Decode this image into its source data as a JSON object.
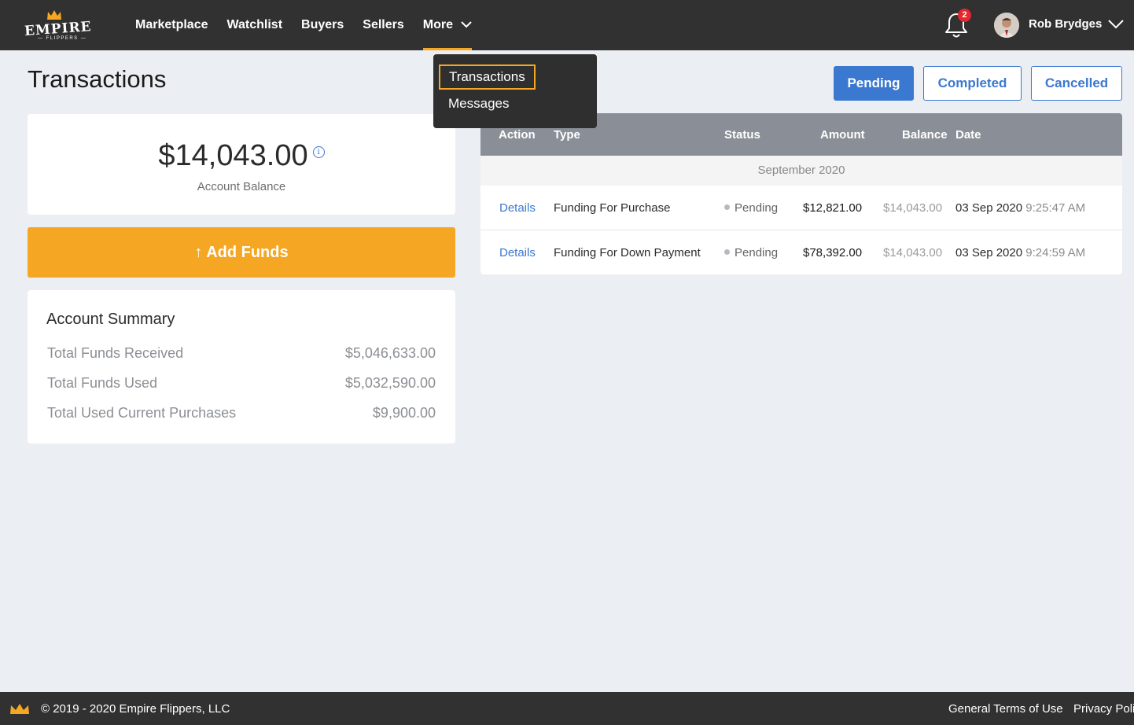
{
  "brand": {
    "name": "EMPIRE",
    "sub": "— FLIPPERS —",
    "accent": "#f5a623",
    "link_color": "#3b78d0"
  },
  "nav": {
    "items": [
      "Marketplace",
      "Watchlist",
      "Buyers",
      "Sellers"
    ],
    "more_label": "More"
  },
  "notifications": {
    "count": "2"
  },
  "user": {
    "name": "Rob Brydges"
  },
  "dropdown": {
    "items": [
      "Transactions",
      "Messages"
    ]
  },
  "page": {
    "title": "Transactions"
  },
  "balance": {
    "amount": "$14,043.00",
    "label": "Account Balance",
    "info_icon": "i"
  },
  "add_funds": {
    "label": "↑ Add Funds"
  },
  "summary": {
    "title": "Account Summary",
    "rows": [
      {
        "label": "Total Funds Received",
        "value": "$5,046,633.00"
      },
      {
        "label": "Total Funds Used",
        "value": "$5,032,590.00"
      },
      {
        "label": "Total Used Current Purchases",
        "value": "$9,900.00"
      }
    ]
  },
  "filters": {
    "pending": "Pending",
    "completed": "Completed",
    "cancelled": "Cancelled"
  },
  "table": {
    "headers": [
      "Action",
      "Type",
      "Status",
      "Amount",
      "Balance",
      "Date"
    ],
    "month": "September 2020",
    "rows": [
      {
        "action": "Details",
        "type": "Funding For Purchase",
        "status": "Pending",
        "amount": "$12,821.00",
        "balance": "$14,043.00",
        "date": "03 Sep 2020",
        "time": "9:25:47 AM"
      },
      {
        "action": "Details",
        "type": "Funding For Down Payment",
        "status": "Pending",
        "amount": "$78,392.00",
        "balance": "$14,043.00",
        "date": "03 Sep 2020",
        "time": "9:24:59 AM"
      }
    ]
  },
  "footer": {
    "copyright": "© 2019 - 2020 Empire Flippers, LLC",
    "terms": "General Terms of Use",
    "privacy": "Privacy Policy"
  }
}
